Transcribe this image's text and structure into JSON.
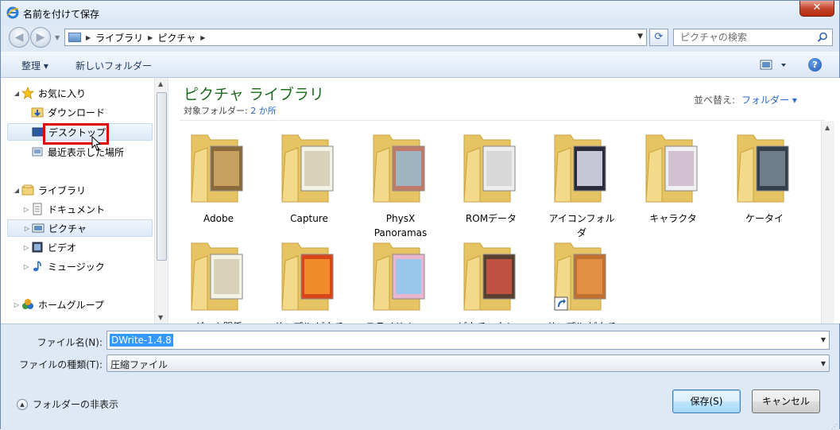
{
  "window": {
    "title": "名前を付けて保存",
    "close_label": "✕"
  },
  "address": {
    "crumbs": [
      "ライブラリ",
      "ピクチャ"
    ],
    "search_placeholder": "ピクチャの検索"
  },
  "toolbar": {
    "organize_label": "整理 ▾",
    "new_folder_label": "新しいフォルダー",
    "help_label": "?"
  },
  "nav": {
    "favorites": "お気に入り",
    "downloads": "ダウンロード",
    "desktop": "デスクトップ",
    "recent": "最近表示した場所",
    "libraries": "ライブラリ",
    "documents": "ドキュメント",
    "pictures": "ピクチャ",
    "videos": "ビデオ",
    "music": "ミュージック",
    "homegroup": "ホームグループ"
  },
  "library": {
    "title": "ピクチャ ライブラリ",
    "subtitle_label": "対象フォルダー: ",
    "subtitle_count": "2 か所",
    "sort_label": "並べ替え:",
    "sort_value": "フォルダー ▾"
  },
  "folders": [
    {
      "name": "Adobe"
    },
    {
      "name": "Capture"
    },
    {
      "name": "PhysX\nPanoramas"
    },
    {
      "name": "ROMデータ"
    },
    {
      "name": "アイコンフォル\nダ"
    },
    {
      "name": "キャラクタ"
    },
    {
      "name": "ケータイ"
    },
    {
      "name": "ゲーム関係"
    },
    {
      "name": "サンプル ピクチ"
    },
    {
      "name": "スライド ショー"
    },
    {
      "name": "ピカチュウショ"
    },
    {
      "name": "サンプル ピクチ"
    }
  ],
  "form": {
    "filename_label": "ファイル名(N):",
    "filename_value": "DWrite-1.4.8",
    "filetype_label": "ファイルの種類(T):",
    "filetype_value": "圧縮ファイル",
    "hide_folders_label": "フォルダーの非表示",
    "save_label": "保存(S)",
    "cancel_label": "キャンセル"
  },
  "colors": {
    "library_title": "#1e6b1e",
    "link": "#2a6bc6",
    "highlight_box": "#e00000",
    "selection": "#3399ff"
  }
}
